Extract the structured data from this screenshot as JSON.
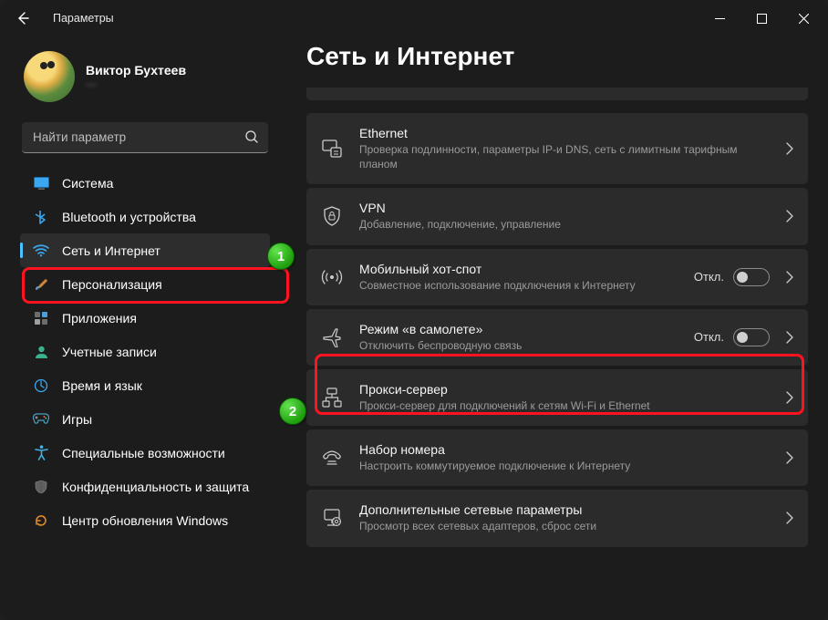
{
  "window": {
    "title": "Параметры"
  },
  "user": {
    "name": "Виктор Бухтеев",
    "email": "—"
  },
  "search": {
    "placeholder": "Найти параметр"
  },
  "sidebar": {
    "items": [
      {
        "label": "Система"
      },
      {
        "label": "Bluetooth и устройства"
      },
      {
        "label": "Сеть и Интернет"
      },
      {
        "label": "Персонализация"
      },
      {
        "label": "Приложения"
      },
      {
        "label": "Учетные записи"
      },
      {
        "label": "Время и язык"
      },
      {
        "label": "Игры"
      },
      {
        "label": "Специальные возможности"
      },
      {
        "label": "Конфиденциальность и защита"
      },
      {
        "label": "Центр обновления Windows"
      }
    ]
  },
  "page": {
    "heading": "Сеть и Интернет"
  },
  "cards": {
    "ethernet": {
      "title": "Ethernet",
      "sub": "Проверка подлинности, параметры IP-и DNS, сеть с лимитным тарифным планом"
    },
    "vpn": {
      "title": "VPN",
      "sub": "Добавление, подключение, управление"
    },
    "hotspot": {
      "title": "Мобильный хот-спот",
      "sub": "Совместное использование подключения к Интернету",
      "toggle": "Откл."
    },
    "airplane": {
      "title": "Режим «в самолете»",
      "sub": "Отключить беспроводную связь",
      "toggle": "Откл."
    },
    "proxy": {
      "title": "Прокси-сервер",
      "sub": "Прокси-сервер для подключений к сетям Wi-Fi и Ethernet"
    },
    "dialup": {
      "title": "Набор номера",
      "sub": "Настроить коммутируемое подключение к Интернету"
    },
    "advanced": {
      "title": "Дополнительные сетевые параметры",
      "sub": "Просмотр всех сетевых адаптеров, сброс сети"
    }
  },
  "markers": {
    "one": "1",
    "two": "2"
  }
}
